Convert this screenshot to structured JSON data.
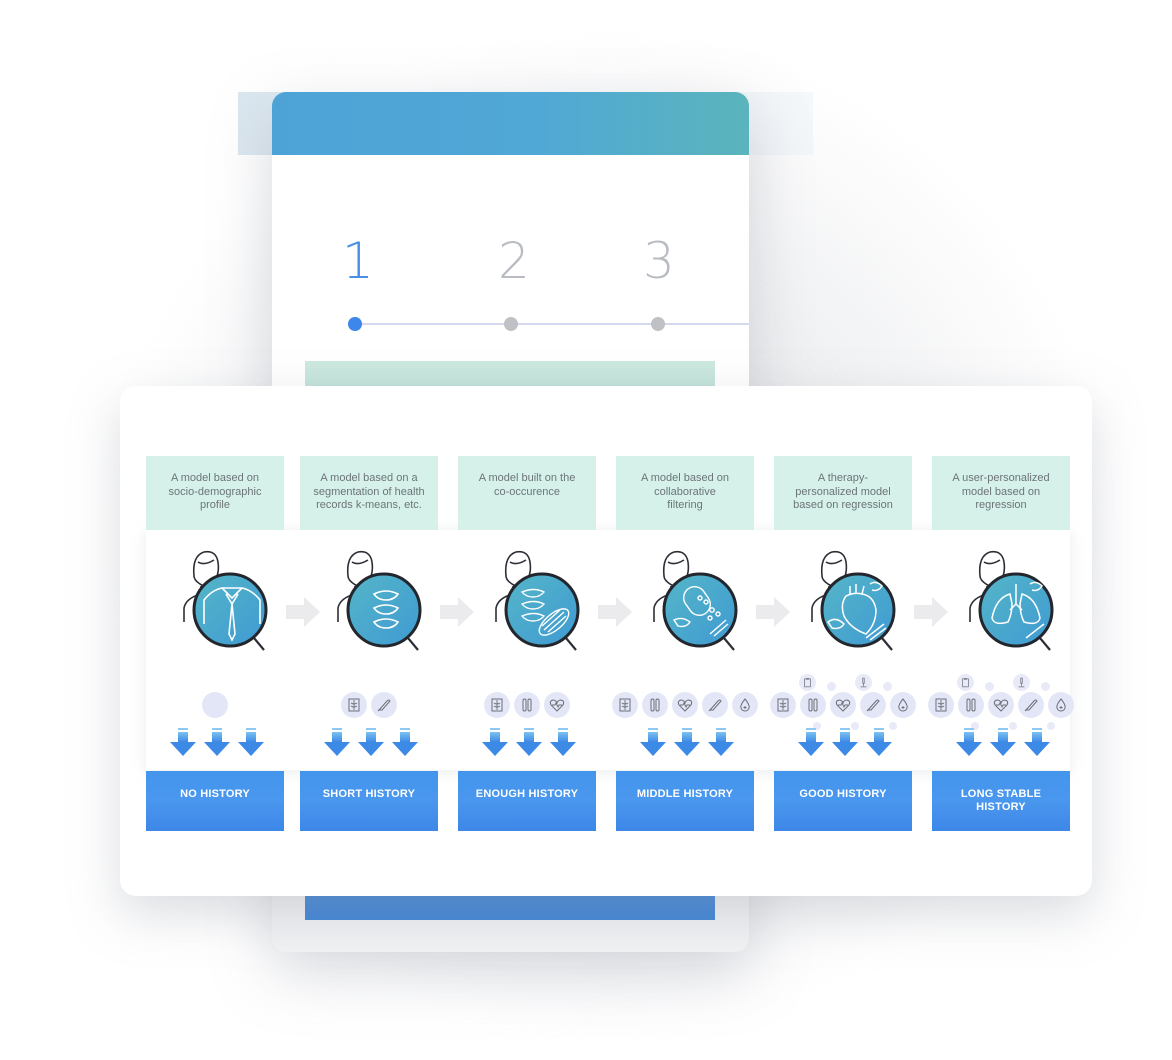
{
  "stepper": {
    "steps": [
      {
        "number": "1",
        "state": "active"
      },
      {
        "number": "2",
        "state": "inactive"
      },
      {
        "number": "3",
        "state": "inactive"
      }
    ]
  },
  "colors": {
    "header_gradient_start": "#4ea3d6",
    "header_gradient_end": "#5ab4bc",
    "active_step": "#3d86ea",
    "inactive_step": "#bfc1c5",
    "description_bg": "#d5f1ea",
    "label_button": "#4395ec",
    "lens_fill": "#44a6cc",
    "data_icon_bg": "#e3e6f6"
  },
  "stages": [
    {
      "description": "A model based on\nsocio-demographic\nprofile",
      "label": "NO HISTORY",
      "lens_icon": "shirt-tie-icon",
      "data_icons": [],
      "placeholder_bubble": true
    },
    {
      "description": "A model based on a\nsegmentation of health\nrecords k-means, etc.",
      "label": "SHORT HISTORY",
      "lens_icon": "spine-icon",
      "data_icons": [
        "xray-icon",
        "thermometer-icon"
      ]
    },
    {
      "description": "A model built on the\nco-occurence",
      "label": "ENOUGH HISTORY",
      "lens_icon": "spine-muscle-icon",
      "data_icons": [
        "xray-icon",
        "test-tubes-icon",
        "heart-rate-icon"
      ]
    },
    {
      "description": "A model based on\ncollaborative\nfiltering",
      "label": "MIDDLE HISTORY",
      "lens_icon": "pills-icon",
      "data_icons": [
        "xray-icon",
        "test-tubes-icon",
        "heart-rate-icon",
        "thermometer-icon",
        "blood-drop-icon"
      ]
    },
    {
      "description": "A therapy-\npersonalized model\nbased on regression",
      "label": "GOOD HISTORY",
      "lens_icon": "heart-organ-icon",
      "data_icons": [
        "xray-icon",
        "test-tubes-icon",
        "heart-rate-icon",
        "thermometer-icon",
        "blood-drop-icon"
      ],
      "extra_icons": [
        "clipboard-icon",
        "microscope-icon"
      ]
    },
    {
      "description": "A user-personalized\nmodel based on\nregression",
      "label": "LONG STABLE\nHISTORY",
      "lens_icon": "lungs-icon",
      "data_icons": [
        "xray-icon",
        "test-tubes-icon",
        "heart-rate-icon",
        "thermometer-icon",
        "blood-drop-icon"
      ],
      "extra_icons": [
        "clipboard-icon",
        "microscope-icon"
      ]
    }
  ]
}
